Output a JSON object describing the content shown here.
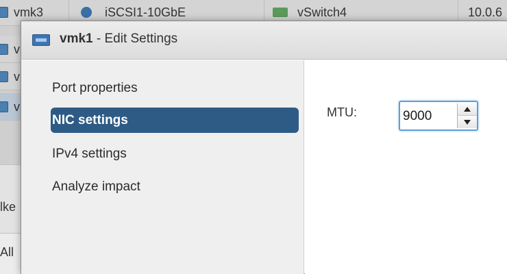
{
  "background": {
    "rows": [
      {
        "col1": "vmk3",
        "col2": "iSCSI1-10GbE",
        "col3": "vSwitch4",
        "col4": "10.0.6"
      },
      {
        "col1": "v",
        "col2": "",
        "col3": "",
        "col4": ""
      },
      {
        "col1": "v",
        "col2": "",
        "col3": "",
        "col4": ""
      },
      {
        "col1": "v",
        "col2": "",
        "col3": "",
        "col4": ""
      }
    ],
    "lower_text_1": "lke",
    "lower_text_2": "All"
  },
  "dialog": {
    "title_name": "vmk1",
    "title_rest": " - Edit Settings",
    "nav": [
      {
        "label": "Port properties"
      },
      {
        "label": "NIC settings"
      },
      {
        "label": "IPv4 settings"
      },
      {
        "label": "Analyze impact"
      }
    ],
    "mtu": {
      "label": "MTU:",
      "value": "9000"
    }
  }
}
